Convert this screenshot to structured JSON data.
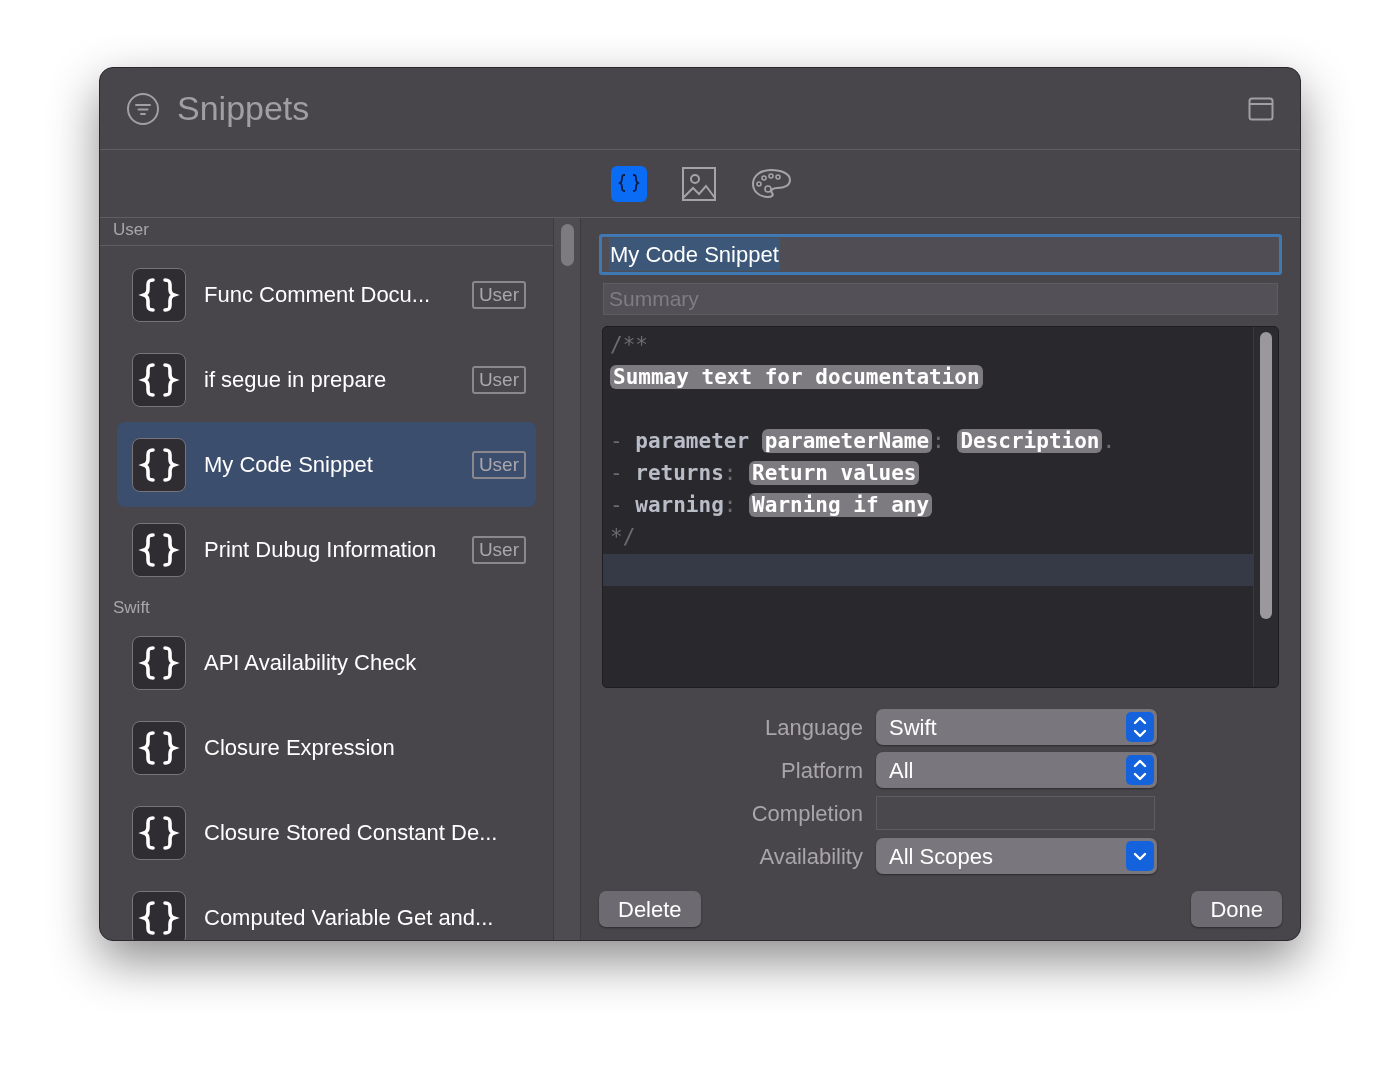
{
  "window": {
    "title": "Snippets"
  },
  "toolbar": {
    "tabs": [
      {
        "kind": "code",
        "selected": true
      },
      {
        "kind": "image",
        "selected": false
      },
      {
        "kind": "palette",
        "selected": false
      }
    ]
  },
  "sidebar": {
    "groups": [
      {
        "title": "User",
        "items": [
          {
            "title": "Func Comment Docu...",
            "badge": "User",
            "selected": false
          },
          {
            "title": "if segue in prepare",
            "badge": "User",
            "selected": false
          },
          {
            "title": "My Code Snippet",
            "badge": "User",
            "selected": true
          },
          {
            "title": "Print Dubug Information",
            "badge": "User",
            "selected": false
          }
        ]
      },
      {
        "title": "Swift",
        "items": [
          {
            "title": "API Availability Check",
            "selected": false
          },
          {
            "title": "Closure Expression",
            "selected": false
          },
          {
            "title": "Closure Stored Constant De...",
            "selected": false
          },
          {
            "title": "Computed Variable Get and...",
            "selected": false
          }
        ]
      }
    ]
  },
  "editor": {
    "name_field": {
      "value": "My Code Snippet",
      "focused": true
    },
    "summary_field": {
      "placeholder": "Summary"
    },
    "code": [
      {
        "current": false,
        "segments": [
          {
            "kind": "comment",
            "text": "/**"
          }
        ]
      },
      {
        "current": false,
        "segments": [
          {
            "kind": "token",
            "text": "Summay text for documentation"
          }
        ]
      },
      {
        "current": false
      },
      {
        "current": false,
        "segments": [
          {
            "kind": "comment",
            "text": "- "
          },
          {
            "kind": "keyword",
            "text": "parameter "
          },
          {
            "kind": "token",
            "text": "parameterName"
          },
          {
            "kind": "comment",
            "text": ": "
          },
          {
            "kind": "token",
            "text": "Description"
          },
          {
            "kind": "comment",
            "text": "."
          }
        ]
      },
      {
        "current": false,
        "segments": [
          {
            "kind": "comment",
            "text": "- "
          },
          {
            "kind": "keyword",
            "text": "returns"
          },
          {
            "kind": "comment",
            "text": ": "
          },
          {
            "kind": "token",
            "text": "Return values"
          }
        ]
      },
      {
        "current": false,
        "segments": [
          {
            "kind": "comment",
            "text": "- "
          },
          {
            "kind": "keyword",
            "text": "warning"
          },
          {
            "kind": "comment",
            "text": ": "
          },
          {
            "kind": "token",
            "text": "Warning if any"
          }
        ]
      },
      {
        "current": false,
        "segments": [
          {
            "kind": "comment",
            "text": "*/"
          }
        ]
      },
      {
        "current": true
      }
    ],
    "fields": [
      {
        "label": "Language",
        "kind": "popup",
        "value": "Swift"
      },
      {
        "label": "Platform",
        "kind": "popup",
        "value": "All"
      },
      {
        "label": "Completion",
        "kind": "text"
      },
      {
        "label": "Availability",
        "kind": "pulldown",
        "value": "All Scopes"
      }
    ],
    "buttons": [
      {
        "label": "Delete"
      },
      {
        "label": "Done"
      }
    ]
  }
}
